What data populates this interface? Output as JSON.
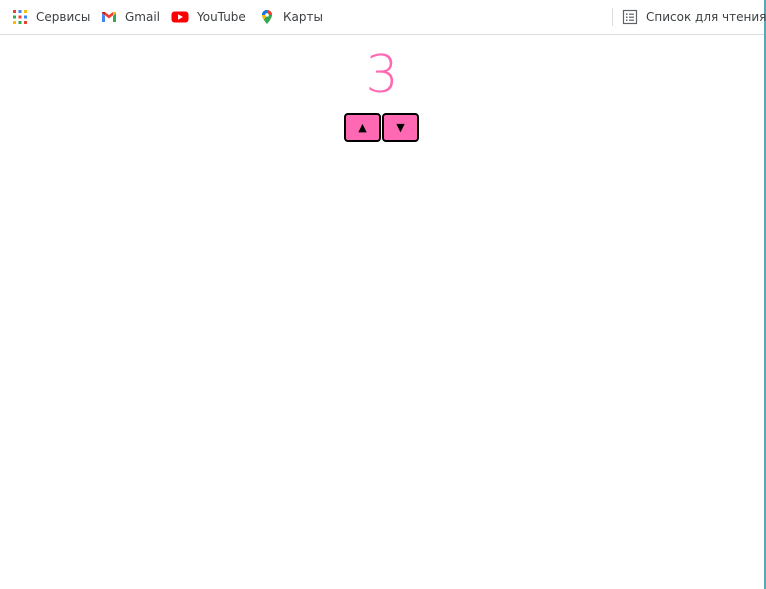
{
  "bookmarks_bar": {
    "items": [
      {
        "label": "Сервисы",
        "icon": "apps-grid-icon"
      },
      {
        "label": "Gmail",
        "icon": "gmail-icon"
      },
      {
        "label": "YouTube",
        "icon": "youtube-icon"
      },
      {
        "label": "Карты",
        "icon": "maps-pin-icon"
      }
    ],
    "reading_list": {
      "label": "Список для чтения",
      "icon": "reading-list-icon"
    }
  },
  "counter": {
    "value": "3",
    "color": "#ff69b4",
    "up_label": "▲",
    "down_label": "▼",
    "button_color": "#ff69b4"
  }
}
